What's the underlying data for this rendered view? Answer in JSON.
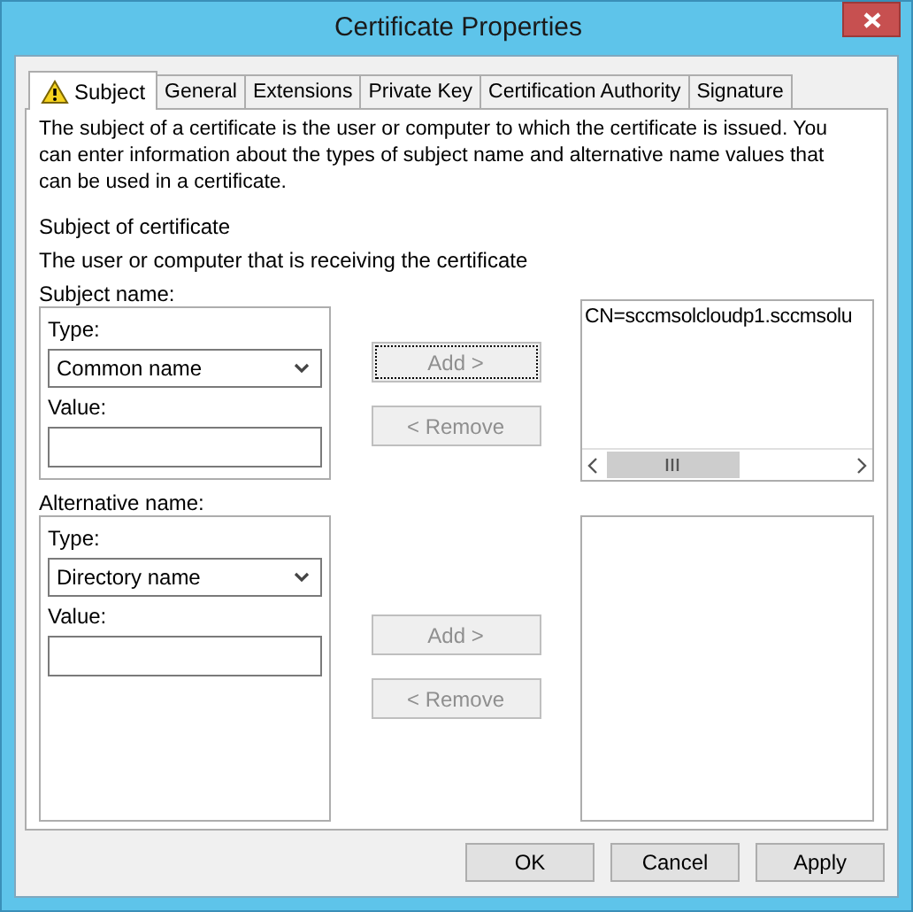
{
  "window": {
    "title": "Certificate Properties"
  },
  "tabs": [
    {
      "label": "Subject",
      "selected": true,
      "warning": true
    },
    {
      "label": "General",
      "selected": false,
      "warning": false
    },
    {
      "label": "Extensions",
      "selected": false,
      "warning": false
    },
    {
      "label": "Private Key",
      "selected": false,
      "warning": false
    },
    {
      "label": "Certification Authority",
      "selected": false,
      "warning": false
    },
    {
      "label": "Signature",
      "selected": false,
      "warning": false
    }
  ],
  "description": "The subject of a certificate is the user or computer to which the certificate is issued. You can enter information about the types of subject name and alternative name values that can be used in a certificate.",
  "section_title": "Subject of certificate",
  "section_subtitle": "The user or computer that is receiving the certificate",
  "groups": [
    {
      "label": "Subject name:",
      "type_label": "Type:",
      "type_value": "Common name",
      "value_label": "Value:",
      "buttons": [
        {
          "label": "Add >",
          "disabled": true,
          "focused": true
        },
        {
          "label": "< Remove",
          "disabled": true,
          "focused": false
        }
      ],
      "list": {
        "items": [
          "CN=sccmsolcloudp1.sccmsolu"
        ],
        "horizontal_scrollbar": true
      }
    },
    {
      "label": "Alternative name:",
      "type_label": "Type:",
      "type_value": "Directory name",
      "value_label": "Value:",
      "buttons": [
        {
          "label": "Add >",
          "disabled": true,
          "focused": false
        },
        {
          "label": "< Remove",
          "disabled": true,
          "focused": false
        }
      ],
      "list": {
        "horizontal_scrollbar": false
      }
    }
  ],
  "footer_buttons": [
    {
      "label": "OK"
    },
    {
      "label": "Cancel"
    },
    {
      "label": "Apply"
    }
  ]
}
